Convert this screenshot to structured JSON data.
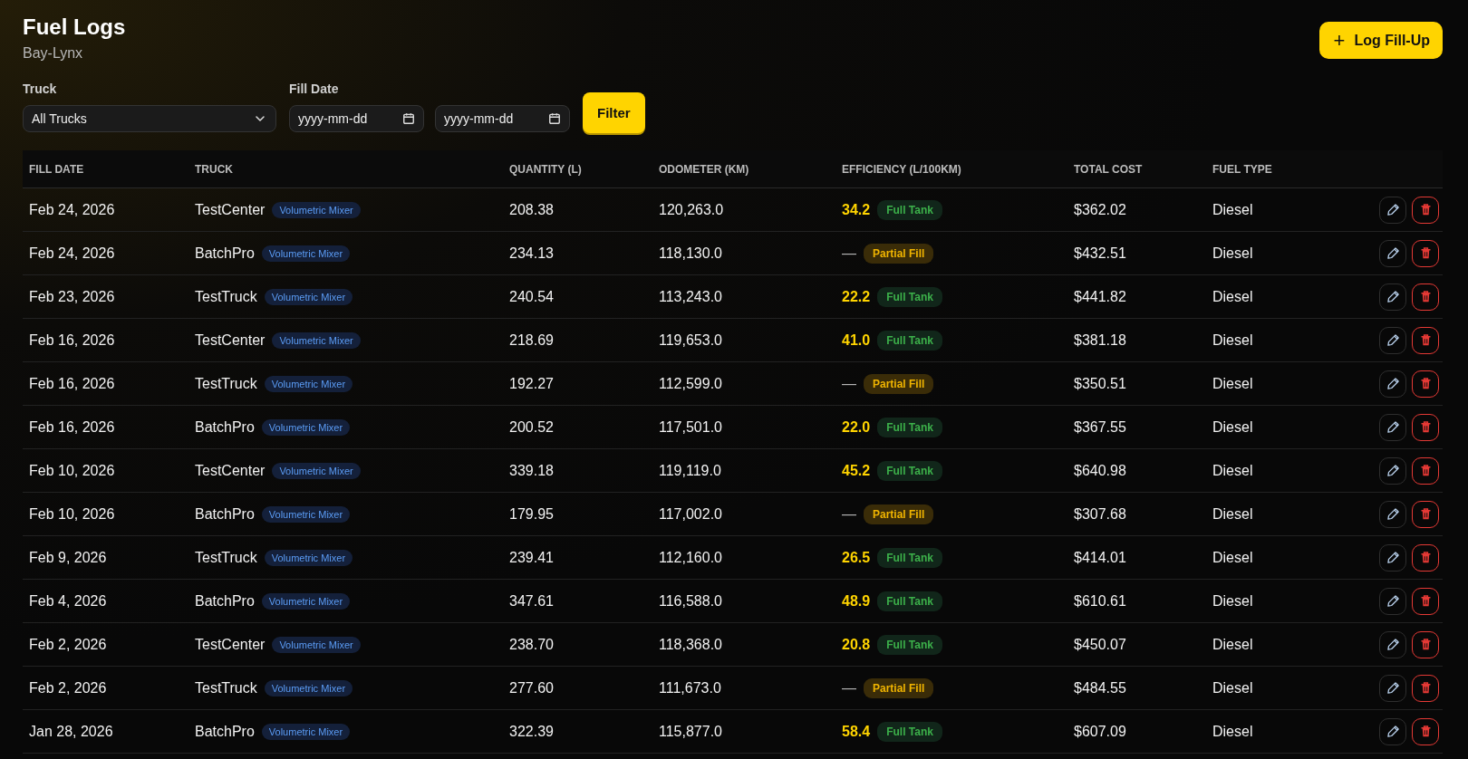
{
  "header": {
    "title": "Fuel Logs",
    "subtitle": "Bay-Lynx",
    "add_button": {
      "icon": "+",
      "label": "Log Fill-Up"
    }
  },
  "filters": {
    "truck": {
      "label": "Truck",
      "value": "All Trucks"
    },
    "fill_date": {
      "label": "Fill Date",
      "from": {
        "placeholder": "yyyy-mm-dd"
      },
      "to": {
        "placeholder": "yyyy-mm-dd"
      }
    },
    "button": "Filter"
  },
  "table": {
    "columns": [
      "FILL DATE",
      "TRUCK",
      "QUANTITY (L)",
      "ODOMETER (KM)",
      "EFFICIENCY (L/100KM)",
      "TOTAL COST",
      "FUEL TYPE"
    ],
    "rows": [
      {
        "date": "Feb 24, 2026",
        "truck": "TestCenter",
        "truck_type": "Volumetric Mixer",
        "quantity": "208.38",
        "odometer": "120,263.0",
        "efficiency": "34.2",
        "fill": {
          "kind": "full",
          "label": "Full Tank"
        },
        "cost": "$362.02",
        "fuel": "Diesel"
      },
      {
        "date": "Feb 24, 2026",
        "truck": "BatchPro",
        "truck_type": "Volumetric Mixer",
        "quantity": "234.13",
        "odometer": "118,130.0",
        "efficiency": "—",
        "fill": {
          "kind": "partial",
          "label": "Partial Fill"
        },
        "cost": "$432.51",
        "fuel": "Diesel"
      },
      {
        "date": "Feb 23, 2026",
        "truck": "TestTruck",
        "truck_type": "Volumetric Mixer",
        "quantity": "240.54",
        "odometer": "113,243.0",
        "efficiency": "22.2",
        "fill": {
          "kind": "full",
          "label": "Full Tank"
        },
        "cost": "$441.82",
        "fuel": "Diesel"
      },
      {
        "date": "Feb 16, 2026",
        "truck": "TestCenter",
        "truck_type": "Volumetric Mixer",
        "quantity": "218.69",
        "odometer": "119,653.0",
        "efficiency": "41.0",
        "fill": {
          "kind": "full",
          "label": "Full Tank"
        },
        "cost": "$381.18",
        "fuel": "Diesel"
      },
      {
        "date": "Feb 16, 2026",
        "truck": "TestTruck",
        "truck_type": "Volumetric Mixer",
        "quantity": "192.27",
        "odometer": "112,599.0",
        "efficiency": "—",
        "fill": {
          "kind": "partial",
          "label": "Partial Fill"
        },
        "cost": "$350.51",
        "fuel": "Diesel"
      },
      {
        "date": "Feb 16, 2026",
        "truck": "BatchPro",
        "truck_type": "Volumetric Mixer",
        "quantity": "200.52",
        "odometer": "117,501.0",
        "efficiency": "22.0",
        "fill": {
          "kind": "full",
          "label": "Full Tank"
        },
        "cost": "$367.55",
        "fuel": "Diesel"
      },
      {
        "date": "Feb 10, 2026",
        "truck": "TestCenter",
        "truck_type": "Volumetric Mixer",
        "quantity": "339.18",
        "odometer": "119,119.0",
        "efficiency": "45.2",
        "fill": {
          "kind": "full",
          "label": "Full Tank"
        },
        "cost": "$640.98",
        "fuel": "Diesel"
      },
      {
        "date": "Feb 10, 2026",
        "truck": "BatchPro",
        "truck_type": "Volumetric Mixer",
        "quantity": "179.95",
        "odometer": "117,002.0",
        "efficiency": "—",
        "fill": {
          "kind": "partial",
          "label": "Partial Fill"
        },
        "cost": "$307.68",
        "fuel": "Diesel"
      },
      {
        "date": "Feb 9, 2026",
        "truck": "TestTruck",
        "truck_type": "Volumetric Mixer",
        "quantity": "239.41",
        "odometer": "112,160.0",
        "efficiency": "26.5",
        "fill": {
          "kind": "full",
          "label": "Full Tank"
        },
        "cost": "$414.01",
        "fuel": "Diesel"
      },
      {
        "date": "Feb 4, 2026",
        "truck": "BatchPro",
        "truck_type": "Volumetric Mixer",
        "quantity": "347.61",
        "odometer": "116,588.0",
        "efficiency": "48.9",
        "fill": {
          "kind": "full",
          "label": "Full Tank"
        },
        "cost": "$610.61",
        "fuel": "Diesel"
      },
      {
        "date": "Feb 2, 2026",
        "truck": "TestCenter",
        "truck_type": "Volumetric Mixer",
        "quantity": "238.70",
        "odometer": "118,368.0",
        "efficiency": "20.8",
        "fill": {
          "kind": "full",
          "label": "Full Tank"
        },
        "cost": "$450.07",
        "fuel": "Diesel"
      },
      {
        "date": "Feb 2, 2026",
        "truck": "TestTruck",
        "truck_type": "Volumetric Mixer",
        "quantity": "277.60",
        "odometer": "111,673.0",
        "efficiency": "—",
        "fill": {
          "kind": "partial",
          "label": "Partial Fill"
        },
        "cost": "$484.55",
        "fuel": "Diesel"
      },
      {
        "date": "Jan 28, 2026",
        "truck": "BatchPro",
        "truck_type": "Volumetric Mixer",
        "quantity": "322.39",
        "odometer": "115,877.0",
        "efficiency": "58.4",
        "fill": {
          "kind": "full",
          "label": "Full Tank"
        },
        "cost": "$607.09",
        "fuel": "Diesel"
      }
    ]
  }
}
